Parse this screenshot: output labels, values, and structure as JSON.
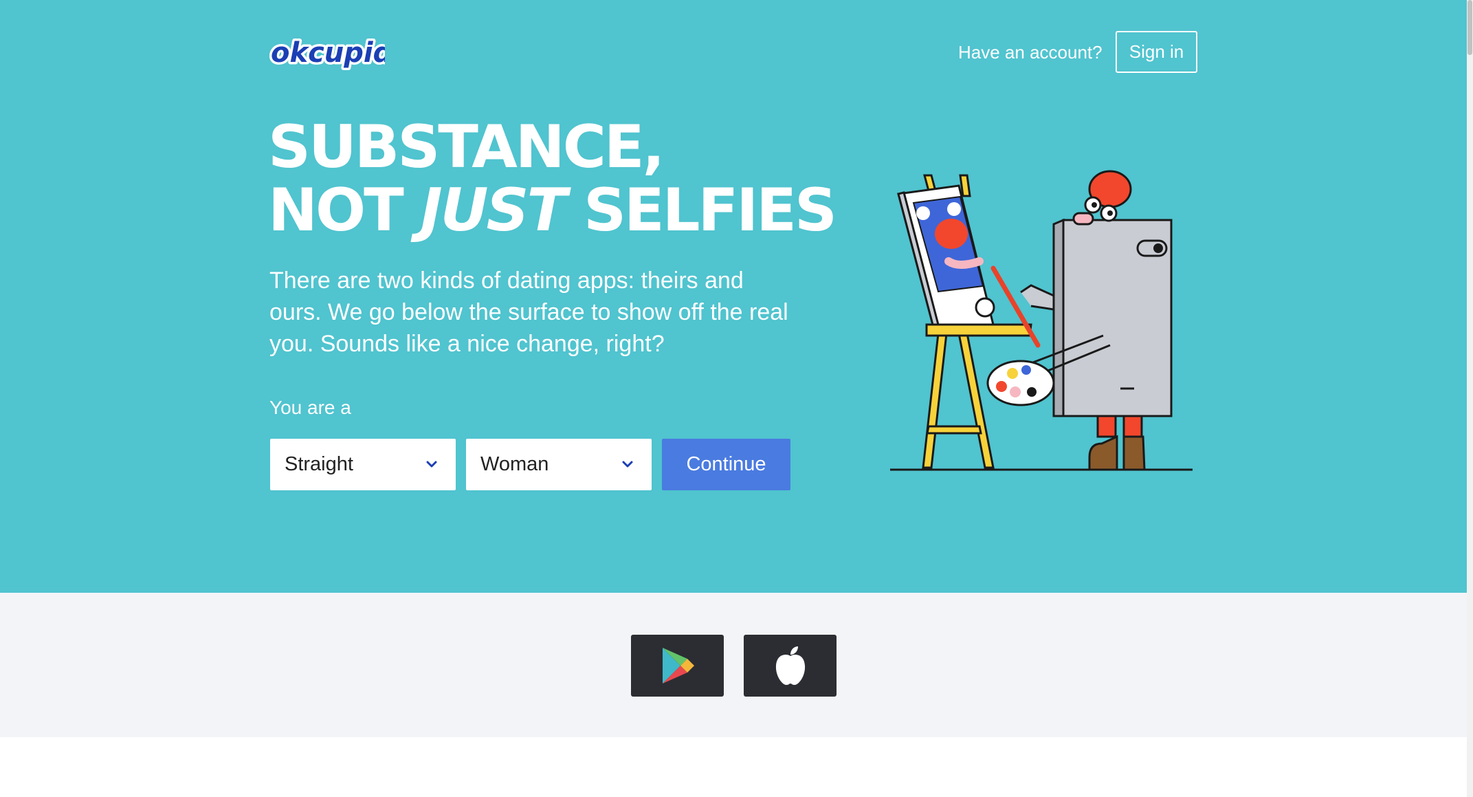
{
  "header": {
    "logo_text": "okcupid",
    "account_prompt": "Have an account?",
    "signin_label": "Sign in"
  },
  "hero": {
    "headline_line1": "SUBSTANCE,",
    "headline_line2_a": "NOT ",
    "headline_line2_b": "JUST",
    "headline_line2_c": " SELFIES",
    "subtext": "There are two kinds of dating apps: theirs and ours. We go below the surface to show off the real you. Sounds like a nice change, right?",
    "you_are_label": "You are a",
    "orientation_value": "Straight",
    "gender_value": "Woman",
    "continue_label": "Continue"
  },
  "apps": {
    "google_play_icon": "google-play-icon",
    "apple_icon": "apple-icon"
  },
  "colors": {
    "hero_bg": "#50c4cf",
    "button_blue": "#4a7be0",
    "strip_bg": "#f3f4f8",
    "store_btn_bg": "#2b2d33"
  }
}
